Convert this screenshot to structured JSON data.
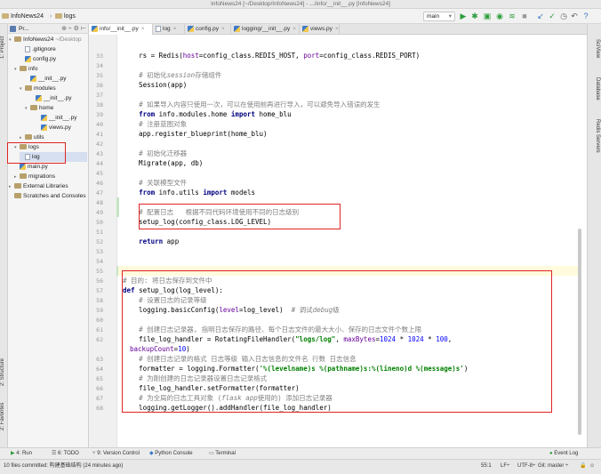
{
  "window": {
    "title": "InfoNews24 [~/Desktop/InfoNews24] - .../info/__init__.py [InfoNews24]"
  },
  "navbar": {
    "crumbs": [
      "InfoNews24",
      "logs"
    ],
    "run_config": "main",
    "tool_icons": [
      "run-icon",
      "debug-icon",
      "coverage-icon",
      "profile-icon",
      "concurrency-icon",
      "stop-icon",
      "vcs-update-icon",
      "vcs-commit-icon",
      "history-icon",
      "revert-icon",
      "help-icon"
    ]
  },
  "left_strip": {
    "tabs": [
      "1: Project",
      "2: Structure",
      "2: Favorites"
    ]
  },
  "right_strip": {
    "tabs": [
      "SciView",
      "Database",
      "Redis Servers"
    ]
  },
  "project": {
    "header_label": "Pr...",
    "tree": [
      {
        "name": "InfoNews24",
        "sub": "~/Desktop",
        "kind": "folder",
        "indent": 0,
        "arrow": "▾"
      },
      {
        "name": ".gitignore",
        "sub": "",
        "kind": "file",
        "indent": 2,
        "arrow": ""
      },
      {
        "name": "config.py",
        "sub": "",
        "kind": "py",
        "indent": 2,
        "arrow": ""
      },
      {
        "name": "info",
        "sub": "",
        "kind": "folder",
        "indent": 1,
        "arrow": "▾"
      },
      {
        "name": "__init__.py",
        "sub": "",
        "kind": "py",
        "indent": 3,
        "arrow": ""
      },
      {
        "name": "modules",
        "sub": "",
        "kind": "folder",
        "indent": 2,
        "arrow": "▾"
      },
      {
        "name": "__init__.py",
        "sub": "",
        "kind": "py",
        "indent": 4,
        "arrow": ""
      },
      {
        "name": "home",
        "sub": "",
        "kind": "folder",
        "indent": 3,
        "arrow": "▾"
      },
      {
        "name": "__init__.py",
        "sub": "",
        "kind": "py",
        "indent": 5,
        "arrow": ""
      },
      {
        "name": "views.py",
        "sub": "",
        "kind": "py",
        "indent": 5,
        "arrow": ""
      },
      {
        "name": "utils",
        "sub": "",
        "kind": "folder",
        "indent": 2,
        "arrow": "▸"
      },
      {
        "name": "logs",
        "sub": "",
        "kind": "folder",
        "indent": 1,
        "arrow": "▾"
      },
      {
        "name": "log",
        "sub": "",
        "kind": "file",
        "indent": 2,
        "arrow": ""
      },
      {
        "name": "main.py",
        "sub": "",
        "kind": "py",
        "indent": 1,
        "arrow": ""
      },
      {
        "name": "migrations",
        "sub": "",
        "kind": "folder",
        "indent": 1,
        "arrow": "▸"
      },
      {
        "name": "External Libraries",
        "sub": "",
        "kind": "lib",
        "indent": 0,
        "arrow": "▸"
      },
      {
        "name": "Scratches and Consoles",
        "sub": "",
        "kind": "lib",
        "indent": 0,
        "arrow": ""
      }
    ]
  },
  "tabs": [
    {
      "label": "info/__init__.py",
      "kind": "py",
      "active": true
    },
    {
      "label": "log",
      "kind": "file",
      "active": false
    },
    {
      "label": "config.py",
      "kind": "py",
      "active": false
    },
    {
      "label": "logging/__init__.py",
      "kind": "py",
      "active": false
    },
    {
      "label": "views.py",
      "kind": "py",
      "active": false
    }
  ],
  "code": {
    "line_numbers": [
      "33",
      "34",
      "35",
      "36",
      "37",
      "38",
      "39",
      "40",
      "41",
      "42",
      "43",
      "44",
      "45",
      "46",
      "47",
      "48",
      "49",
      "50",
      "51",
      "52",
      "53",
      "54",
      "55",
      "56",
      "57",
      "58",
      "59",
      "60",
      "61",
      "62",
      "",
      "63",
      "64",
      "65",
      "66",
      "67",
      "68"
    ],
    "lines": [
      [
        [
          "    ",
          "n"
        ],
        [
          "rs = Redis(",
          "n"
        ],
        [
          "host",
          "prm"
        ],
        [
          "=config_class.REDIS_HOST, ",
          "n"
        ],
        [
          "port",
          "prm"
        ],
        [
          "=config_class.REDIS_PORT)",
          "n"
        ]
      ],
      [
        [
          "",
          "n"
        ]
      ],
      [
        [
          "    ",
          "n"
        ],
        [
          "# 初始化",
          "cm"
        ],
        [
          "session",
          "cmi"
        ],
        [
          "存储组件",
          "cm"
        ]
      ],
      [
        [
          "    Session(app)",
          "n"
        ]
      ],
      [
        [
          "",
          "n"
        ]
      ],
      [
        [
          "    ",
          "n"
        ],
        [
          "# 如果导入内容只使用一次，可以在使用前再进行导入，可以避免导入错误的发生",
          "cm"
        ]
      ],
      [
        [
          "    ",
          "n"
        ],
        [
          "from ",
          "kw"
        ],
        [
          "info.modules.home ",
          "n"
        ],
        [
          "import ",
          "kw"
        ],
        [
          "home_blu",
          "n"
        ]
      ],
      [
        [
          "    ",
          "n"
        ],
        [
          "# 注册蓝图对象",
          "cm"
        ]
      ],
      [
        [
          "    app.register_blueprint(home_blu)",
          "n"
        ]
      ],
      [
        [
          "",
          "n"
        ]
      ],
      [
        [
          "    ",
          "n"
        ],
        [
          "# 初始化迁移器",
          "cm"
        ]
      ],
      [
        [
          "    Migrate(app, db)",
          "n"
        ]
      ],
      [
        [
          "",
          "n"
        ]
      ],
      [
        [
          "    ",
          "n"
        ],
        [
          "# 关联模型文件",
          "cm"
        ]
      ],
      [
        [
          "    ",
          "n"
        ],
        [
          "from ",
          "kw"
        ],
        [
          "info.utils ",
          "n"
        ],
        [
          "import ",
          "kw"
        ],
        [
          "models",
          "n"
        ]
      ],
      [
        [
          "",
          "n"
        ]
      ],
      [
        [
          "    ",
          "n"
        ],
        [
          "# 配置日志   根据不同代码环境使用不同的日志级别",
          "cm"
        ]
      ],
      [
        [
          "    setup_log(config_class.LOG_LEVEL)",
          "n"
        ]
      ],
      [
        [
          "",
          "n"
        ]
      ],
      [
        [
          "    ",
          "n"
        ],
        [
          "return ",
          "kw"
        ],
        [
          "app",
          "n"
        ]
      ],
      [
        [
          "",
          "n"
        ]
      ],
      [
        [
          "",
          "n"
        ]
      ],
      [
        [
          "",
          "n"
        ]
      ],
      [
        [
          "# 目的: 将日志保存到文件中",
          "cm"
        ]
      ],
      [
        [
          "def ",
          "kw"
        ],
        [
          "setup_log(log_level):",
          "n"
        ]
      ],
      [
        [
          "    ",
          "n"
        ],
        [
          "# 设置日志的记录等级",
          "cm"
        ]
      ],
      [
        [
          "    logging.basicConfig(",
          "n"
        ],
        [
          "level",
          "prm"
        ],
        [
          "=log_level)  ",
          "n"
        ],
        [
          "# 调试",
          "cm"
        ],
        [
          "debug",
          "cmi"
        ],
        [
          "级",
          "cm"
        ]
      ],
      [
        [
          "",
          "n"
        ]
      ],
      [
        [
          "    ",
          "n"
        ],
        [
          "# 创建日志记录器, 指明日志保存的路径、每个日志文件的最大大小、保存的日志文件个数上限",
          "cm"
        ]
      ],
      [
        [
          "    file_log_handler = RotatingFileHandler(",
          "n"
        ],
        [
          "\"logs/log\"",
          "str"
        ],
        [
          ", ",
          "n"
        ],
        [
          "maxBytes",
          "prm"
        ],
        [
          "=",
          "n"
        ],
        [
          "1024",
          "num"
        ],
        [
          " * ",
          "n"
        ],
        [
          "1024",
          "num"
        ],
        [
          " * ",
          "n"
        ],
        [
          "100",
          "num"
        ],
        [
          ",",
          "n"
        ]
      ],
      [
        [
          "backupCount",
          "prm"
        ],
        [
          "=",
          "n"
        ],
        [
          "10",
          "num"
        ],
        [
          ")",
          "n"
        ]
      ],
      [
        [
          "    ",
          "n"
        ],
        [
          "# 创建日志记录的格式 日志等级 输入日志信息的文件名 行数 日志信息",
          "cm"
        ]
      ],
      [
        [
          "    formatter = logging.Formatter(",
          "n"
        ],
        [
          "'%(levelname)s %(pathname)s:%(lineno)d %(message)s'",
          "str"
        ],
        [
          ")",
          "n"
        ]
      ],
      [
        [
          "    ",
          "n"
        ],
        [
          "# 为刚创建的日志记录器设置日志记录格式",
          "cm"
        ]
      ],
      [
        [
          "    file_log_handler.setFormatter(formatter)",
          "n"
        ]
      ],
      [
        [
          "    ",
          "n"
        ],
        [
          "# 为全局的日志工具对象 (",
          "cm"
        ],
        [
          "flask app",
          "cmi"
        ],
        [
          "使用的) 添加日志记录器",
          "cm"
        ]
      ],
      [
        [
          "    logging.getLogger().addHandler(file_log_handler)",
          "n"
        ]
      ]
    ]
  },
  "bottom_tools": [
    {
      "icon": "run-icon",
      "label": "4: Run"
    },
    {
      "icon": "todo-icon",
      "label": "6: TODO"
    },
    {
      "icon": "version-control-icon",
      "label": "9: Version Control"
    },
    {
      "icon": "python-console-icon",
      "label": "Python Console"
    },
    {
      "icon": "terminal-icon",
      "label": "Terminal"
    },
    {
      "icon": "event-log-icon",
      "label": "Event Log"
    }
  ],
  "status": {
    "message": "10 files committed: 构建基础结构 (24 minutes ago)",
    "position": "55:1",
    "line_sep": "LF÷",
    "encoding": "UTF-8÷",
    "git": "Git: master ÷"
  }
}
